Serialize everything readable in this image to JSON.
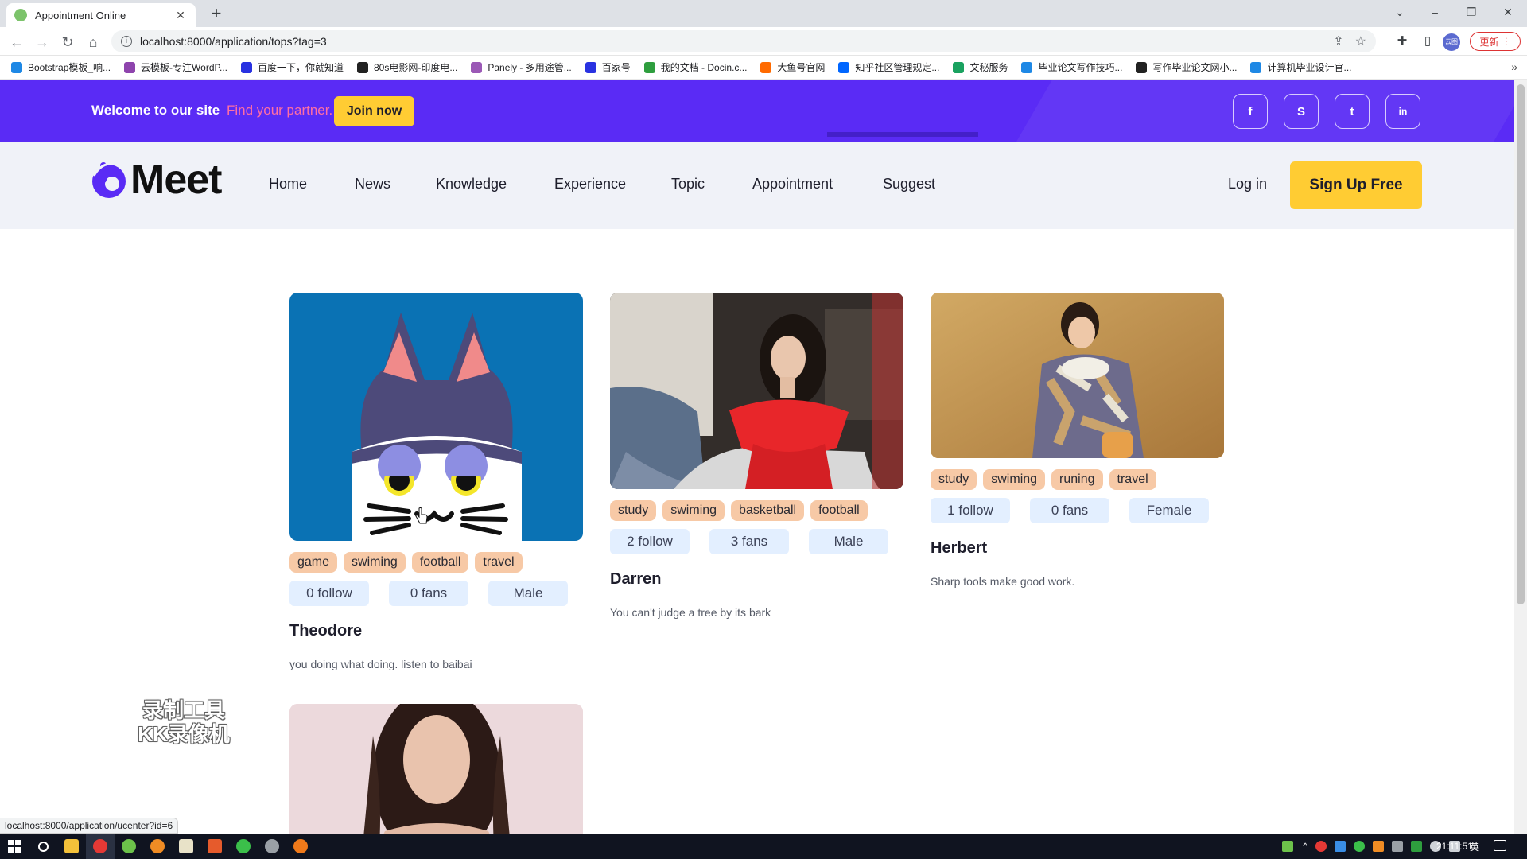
{
  "browser": {
    "tab_title": "Appointment Online",
    "url": "localhost:8000/application/tops?tag=3",
    "update_label": "更新",
    "profile_label": "云图",
    "bookmarks": [
      {
        "label": "Bootstrap模板_响...",
        "color": "#1e88e5"
      },
      {
        "label": "云模板-专注WordP...",
        "color": "#8e44ad"
      },
      {
        "label": "百度一下，你就知道",
        "color": "#2932e1"
      },
      {
        "label": "80s电影网-印度电...",
        "color": "#222222"
      },
      {
        "label": "Panely - 多用途管...",
        "color": "#9b59b6"
      },
      {
        "label": "百家号",
        "color": "#2932e1"
      },
      {
        "label": "我的文档 - Docin.c...",
        "color": "#2e9e3e"
      },
      {
        "label": "大鱼号官网",
        "color": "#ff6a00"
      },
      {
        "label": "知乎社区管理规定...",
        "color": "#0066ff"
      },
      {
        "label": "文秘服务",
        "color": "#1aa260"
      },
      {
        "label": "毕业论文写作技巧...",
        "color": "#1e88e5"
      },
      {
        "label": "写作毕业论文网小...",
        "color": "#222222"
      },
      {
        "label": "计算机毕业设计官...",
        "color": "#1e88e5"
      }
    ],
    "status_url": "localhost:8000/application/ucenter?id=6"
  },
  "topbar": {
    "welcome": "Welcome to our site",
    "highlight": "Find your partner.",
    "join_label": "Join now",
    "social": [
      "f",
      "S",
      "t",
      "in"
    ]
  },
  "nav": {
    "logo_text": "Meet",
    "links": [
      "Home",
      "News",
      "Knowledge",
      "Experience",
      "Topic",
      "Appointment",
      "Suggest"
    ],
    "login": "Log in",
    "signup": "Sign Up Free"
  },
  "cards": [
    {
      "name": "Theodore",
      "tags": [
        "game",
        "swiming",
        "football",
        "travel"
      ],
      "follow": "0 follow",
      "fans": "0 fans",
      "gender": "Male",
      "motto": "you doing what doing. listen to baibai"
    },
    {
      "name": "Darren",
      "tags": [
        "study",
        "swiming",
        "basketball",
        "football"
      ],
      "follow": "2 follow",
      "fans": "3 fans",
      "gender": "Male",
      "motto": "You can't judge a tree by its bark"
    },
    {
      "name": "Herbert",
      "tags": [
        "study",
        "swiming",
        "runing",
        "travel"
      ],
      "follow": "1 follow",
      "fans": "0 fans",
      "gender": "Female",
      "motto": "Sharp tools make good work."
    }
  ],
  "watermark": [
    "录制工具",
    "KK录像机"
  ],
  "taskbar": {
    "clock": "21:11:51",
    "ime": "英"
  }
}
